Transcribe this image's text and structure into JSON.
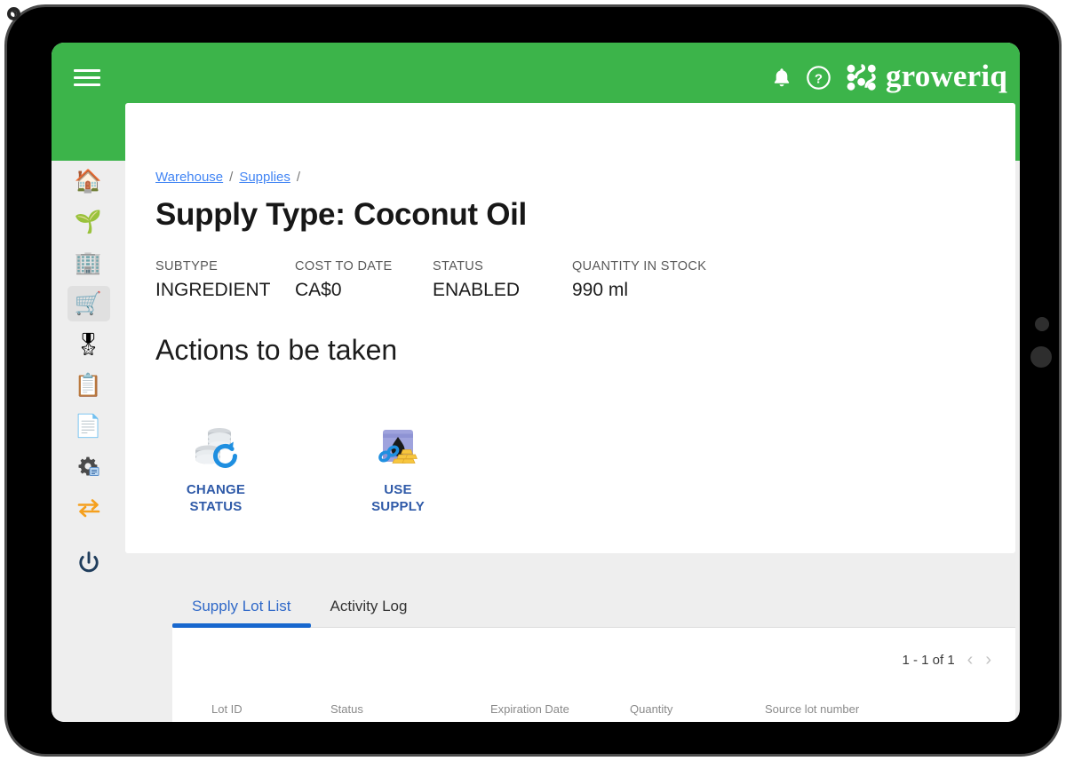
{
  "header": {
    "menu_icon": "hamburger-menu-icon",
    "notifications_icon": "bell-icon",
    "help_icon": "question-mark-circle-icon",
    "logo_mark_icon": "groweriq-dot-grid-logo",
    "brand_name": "groweriq",
    "background_color": "#3cb44a"
  },
  "sidebar": {
    "items": [
      {
        "name": "home",
        "icon": "house-icon",
        "glyph": "🏠",
        "active": false
      },
      {
        "name": "cultivation",
        "icon": "seedling-icon",
        "glyph": "🌱",
        "active": false
      },
      {
        "name": "facility",
        "icon": "office-worker-icon",
        "glyph": "🏢",
        "active": false
      },
      {
        "name": "warehouse",
        "icon": "warehouse-cart-icon",
        "glyph": "🛒",
        "active": true
      },
      {
        "name": "quality",
        "icon": "award-medal-icon",
        "glyph": "🎖",
        "active": false
      },
      {
        "name": "accounting",
        "icon": "clipboard-calculator-icon",
        "glyph": "📋",
        "active": false
      },
      {
        "name": "reports",
        "icon": "document-page-icon",
        "glyph": "📄",
        "active": false
      },
      {
        "name": "settings",
        "icon": "gear-settings-icon",
        "glyph": "⚙",
        "active": false
      },
      {
        "name": "transfers",
        "icon": "swap-arrows-icon",
        "glyph": "⇄",
        "active": false
      },
      {
        "name": "logout",
        "icon": "power-button-icon",
        "glyph": "⏻",
        "active": false
      }
    ]
  },
  "breadcrumb": {
    "items": [
      {
        "label": "Warehouse",
        "link": true
      },
      {
        "label": "Supplies",
        "link": true
      }
    ],
    "separator": "/"
  },
  "page": {
    "title": "Supply Type: Coconut Oil",
    "meta": [
      {
        "label": "SUBTYPE",
        "value": "INGREDIENT"
      },
      {
        "label": "COST TO DATE",
        "value": "CA$0"
      },
      {
        "label": "STATUS",
        "value": "ENABLED"
      },
      {
        "label": "QUANTITY IN STOCK",
        "value": "990 ml"
      }
    ],
    "actions_heading": "Actions to be taken",
    "actions": [
      {
        "label_line1": "CHANGE",
        "label_line2": "STATUS",
        "icon": "coin-stacks-refresh-icon"
      },
      {
        "label_line1": "USE",
        "label_line2": "SUPPLY",
        "icon": "oil-barrel-gold-bars-icon"
      }
    ]
  },
  "tabs": [
    {
      "label": "Supply Lot List",
      "active": true
    },
    {
      "label": "Activity Log",
      "active": false
    }
  ],
  "table": {
    "pagination": {
      "range": "1 - 1 of 1",
      "prev_icon": "chevron-left-icon",
      "next_icon": "chevron-right-icon",
      "prev_glyph": "‹",
      "next_glyph": "›"
    },
    "columns": [
      "Lot ID",
      "Status",
      "Expiration Date",
      "Quantity",
      "Source lot number"
    ],
    "rows": []
  },
  "device": {
    "bezel": [
      "speaker-dot",
      "camera-dot",
      "sensor-indicator"
    ]
  },
  "colors": {
    "brand_green": "#3cb44a",
    "link_blue": "#4285f4",
    "tab_active_blue": "#1767ce",
    "action_label_blue": "#2f5aa8",
    "sidebar_bg": "#eeeeee"
  }
}
